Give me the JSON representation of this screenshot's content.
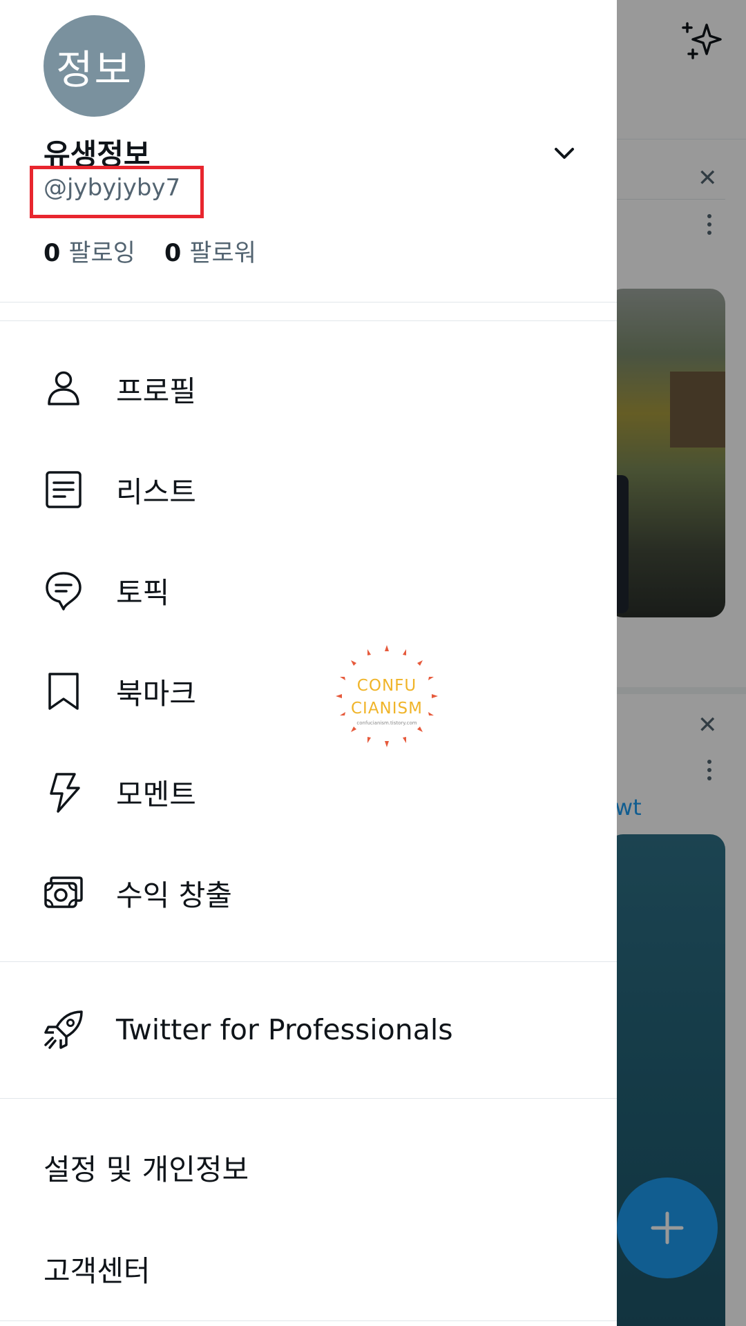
{
  "drawer": {
    "avatar_text": "정보",
    "display_name": "유생정보",
    "handle": "@jybyjyby7",
    "following_count": "0",
    "following_label": "팔로잉",
    "followers_count": "0",
    "followers_label": "팔로워",
    "menu": [
      {
        "label": "프로필",
        "icon": "person-icon"
      },
      {
        "label": "리스트",
        "icon": "list-icon"
      },
      {
        "label": "토픽",
        "icon": "topic-icon"
      },
      {
        "label": "북마크",
        "icon": "bookmark-icon"
      },
      {
        "label": "모멘트",
        "icon": "lightning-icon"
      },
      {
        "label": "수익 창출",
        "icon": "money-icon"
      }
    ],
    "professional": {
      "label": "Twitter for Professionals",
      "icon": "rocket-icon"
    },
    "settings_label": "설정 및 개인정보",
    "help_label": "고객센터"
  },
  "background": {
    "link_fragment": "wt"
  },
  "watermark": {
    "line1": "CONFU",
    "line2": "CIANISM",
    "line3": "confucianism.tistory.com"
  },
  "colors": {
    "accent": "#1d9bf0",
    "highlight_box": "#e8262e",
    "avatar_bg": "#7a919e",
    "text_primary": "#0f1419",
    "text_secondary": "#536471"
  }
}
